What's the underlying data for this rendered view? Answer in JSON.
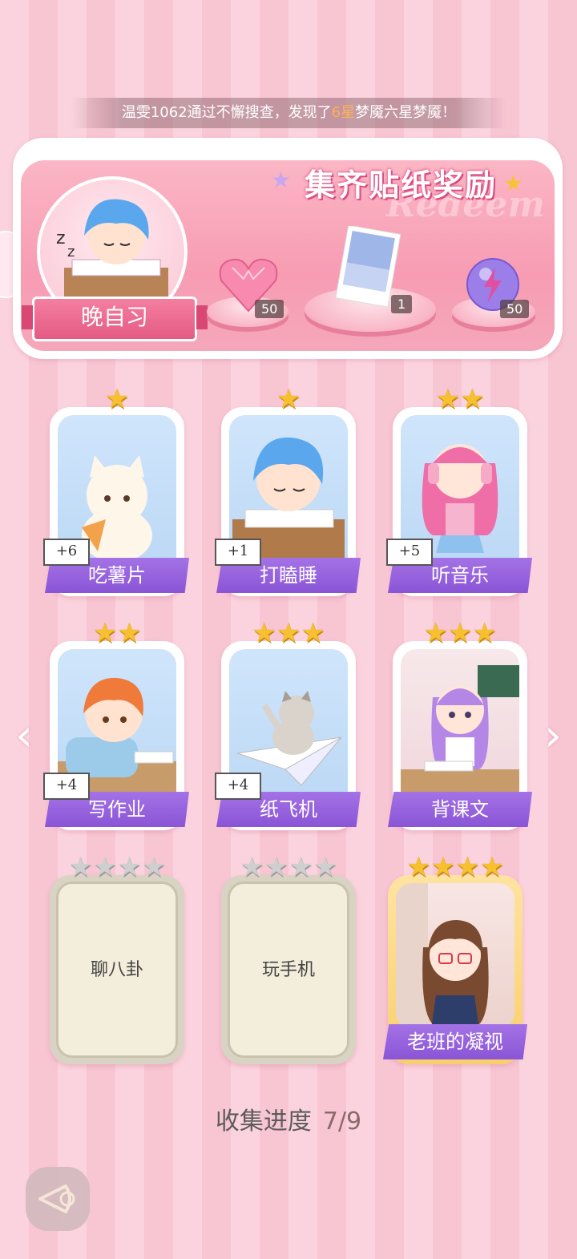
{
  "banner": {
    "prefix": "温雯1062通过不懈搜查，发现了",
    "highlight": "6星",
    "suffix": "梦魇六星梦魇！"
  },
  "reward": {
    "title": "集齐贴纸奖励",
    "watermark": "Redeem",
    "avatar_label": "晚自习",
    "items": [
      {
        "name": "heart-gem-icon",
        "count": "50"
      },
      {
        "name": "photo-card-icon",
        "count": "1"
      },
      {
        "name": "lightning-orb-icon",
        "count": "50"
      }
    ]
  },
  "stickers": [
    {
      "label": "吃薯片",
      "stars": 1,
      "plus": "+6",
      "unlocked": true
    },
    {
      "label": "打瞌睡",
      "stars": 1,
      "plus": "+1",
      "unlocked": true
    },
    {
      "label": "听音乐",
      "stars": 2,
      "plus": "+5",
      "unlocked": true
    },
    {
      "label": "写作业",
      "stars": 2,
      "plus": "+4",
      "unlocked": true
    },
    {
      "label": "纸飞机",
      "stars": 3,
      "plus": "+4",
      "unlocked": true
    },
    {
      "label": "背课文",
      "stars": 3,
      "plus": "",
      "unlocked": true
    },
    {
      "label": "聊八卦",
      "stars": 4,
      "plus": "",
      "unlocked": false
    },
    {
      "label": "玩手机",
      "stars": 4,
      "plus": "",
      "unlocked": false
    },
    {
      "label": "老班的凝视",
      "stars": 4,
      "plus": "",
      "unlocked": true
    }
  ],
  "progress": {
    "label": "收集进度",
    "value": "7/9"
  },
  "colors": {
    "label_purple": "#8a55d6",
    "star_gold": "#f6c030",
    "accent_pink": "#f79cb3"
  }
}
